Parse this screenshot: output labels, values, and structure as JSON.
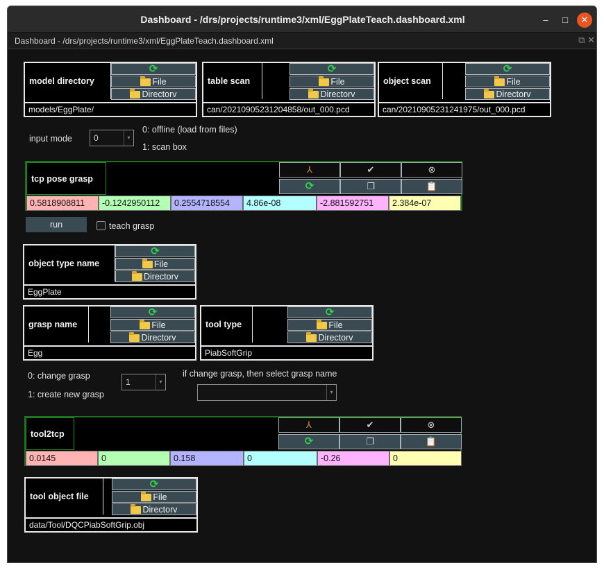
{
  "window": {
    "title": "Dashboard - /drs/projects/runtime3/xml/EggPlateTeach.dashboard.xml",
    "minimize": "–",
    "maximize": "□",
    "close": "✕"
  },
  "subheader": {
    "title": "Dashboard - /drs/projects/runtime3/xml/EggPlateTeach.dashboard.xml",
    "undock": "⧉",
    "close": "✕"
  },
  "buttons": {
    "file": "File",
    "directory": "Directorv"
  },
  "model_directory": {
    "label": "model directory",
    "path": "models/EggPlate/"
  },
  "table_scan": {
    "label": "table scan",
    "path": "can/20210905231204858/out_000.pcd"
  },
  "object_scan": {
    "label": "object scan",
    "path": "can/20210905231241975/out_000.pcd"
  },
  "input_mode": {
    "label": "input mode",
    "value": "0",
    "option0": "0: offline (load from files)",
    "option1": "1: scan box"
  },
  "tcp_pose_grasp": {
    "label": "tcp pose grasp",
    "values": [
      "0.5818908811",
      "-0.1242950112",
      "0.2554718554",
      "4.86e-08",
      "-2.881592751",
      "2.384e-07"
    ]
  },
  "run": {
    "label": "run"
  },
  "teach_grasp": {
    "label": "teach grasp",
    "checked": false
  },
  "object_type_name": {
    "label": "object type name",
    "path": "EggPlate"
  },
  "grasp_name": {
    "label": "grasp name",
    "path": "Egg"
  },
  "tool_type": {
    "label": "tool type",
    "path": "PiabSoftGrip"
  },
  "grasp_mode": {
    "option0": "0: change grasp",
    "option1": "1: create new grasp",
    "value": "1",
    "hint": "if change grasp, then select grasp name",
    "grasp_select_value": ""
  },
  "tool2tcp": {
    "label": "tool2tcp",
    "values": [
      "0.0145",
      "0",
      "0.158",
      "0",
      "-0.26",
      "0"
    ]
  },
  "tool_object_file": {
    "label": "tool object file",
    "path": "data/Tool/DQCPiabSoftGrip.obj"
  },
  "colors": {
    "cell_x": "#ffb3b3",
    "cell_y": "#b3ffb3",
    "cell_z": "#b3b3ff",
    "cell_rx": "#b3ffff",
    "cell_ry": "#ffb3ff",
    "cell_rz": "#ffffb3",
    "accent_green": "#2fd44f",
    "close_orange": "#e95420"
  }
}
